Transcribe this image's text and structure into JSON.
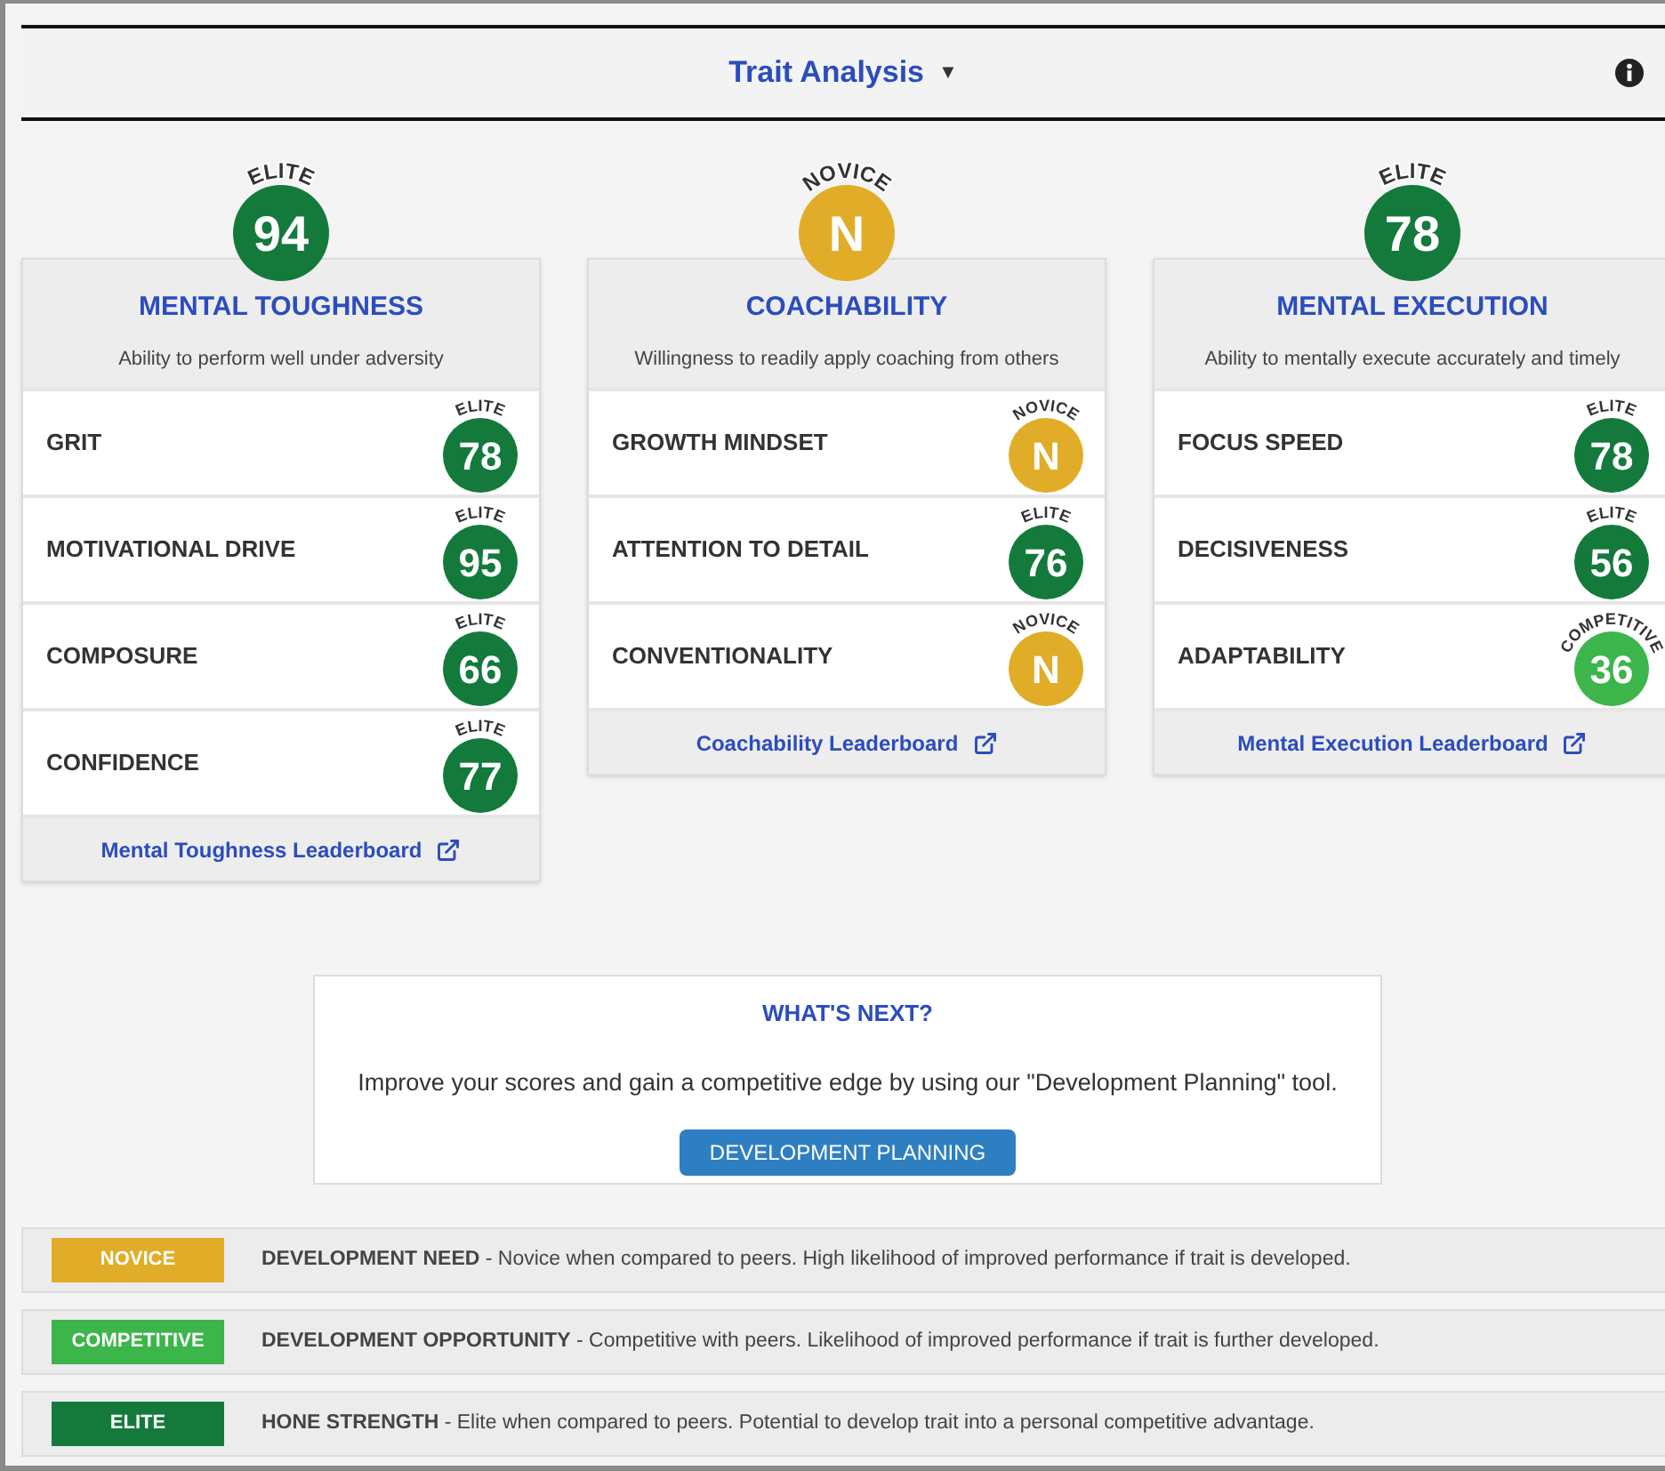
{
  "header": {
    "title": "Trait Analysis",
    "caret": "▼"
  },
  "categories": [
    {
      "title": "MENTAL TOUGHNESS",
      "description": "Ability to perform well under adversity",
      "badge": {
        "rating": "ELITE",
        "value": "94",
        "color": "#137a3c"
      },
      "traits": [
        {
          "name": "GRIT",
          "rating": "ELITE",
          "value": "78",
          "color": "#137a3c"
        },
        {
          "name": "MOTIVATIONAL DRIVE",
          "rating": "ELITE",
          "value": "95",
          "color": "#137a3c"
        },
        {
          "name": "COMPOSURE",
          "rating": "ELITE",
          "value": "66",
          "color": "#137a3c"
        },
        {
          "name": "CONFIDENCE",
          "rating": "ELITE",
          "value": "77",
          "color": "#137a3c"
        }
      ],
      "leaderboard": "Mental Toughness Leaderboard"
    },
    {
      "title": "COACHABILITY",
      "description": "Willingness to readily apply coaching from others",
      "badge": {
        "rating": "NOVICE",
        "value": "N",
        "color": "#e1ad28"
      },
      "traits": [
        {
          "name": "GROWTH MINDSET",
          "rating": "NOVICE",
          "value": "N",
          "color": "#e1ad28"
        },
        {
          "name": "ATTENTION TO DETAIL",
          "rating": "ELITE",
          "value": "76",
          "color": "#137a3c"
        },
        {
          "name": "CONVENTIONALITY",
          "rating": "NOVICE",
          "value": "N",
          "color": "#e1ad28"
        }
      ],
      "leaderboard": "Coachability Leaderboard"
    },
    {
      "title": "MENTAL EXECUTION",
      "description": "Ability to mentally execute accurately and timely",
      "badge": {
        "rating": "ELITE",
        "value": "78",
        "color": "#137a3c"
      },
      "traits": [
        {
          "name": "FOCUS SPEED",
          "rating": "ELITE",
          "value": "78",
          "color": "#137a3c"
        },
        {
          "name": "DECISIVENESS",
          "rating": "ELITE",
          "value": "56",
          "color": "#137a3c"
        },
        {
          "name": "ADAPTABILITY",
          "rating": "COMPETITIVE",
          "value": "36",
          "color": "#3cb54a"
        }
      ],
      "leaderboard": "Mental Execution Leaderboard"
    }
  ],
  "whats_next": {
    "title": "WHAT'S NEXT?",
    "text": "Improve your scores and gain a competitive edge by using our \"Development Planning\" tool.",
    "button": "DEVELOPMENT PLANNING"
  },
  "legend": [
    {
      "label": "NOVICE",
      "color": "#e1ad28",
      "text": "**DEVELOPMENT NEED** - Novice when compared to peers. High likelihood of improved performance if trait is developed."
    },
    {
      "label": "COMPETITIVE",
      "color": "#3cb54a",
      "text": "**DEVELOPMENT OPPORTUNITY** - Competitive with peers. Likelihood of improved performance if trait is further developed."
    },
    {
      "label": "ELITE",
      "color": "#137a3c",
      "text": "**HONE STRENGTH** - Elite when compared to peers. Potential to develop trait into a personal competitive advantage."
    }
  ]
}
